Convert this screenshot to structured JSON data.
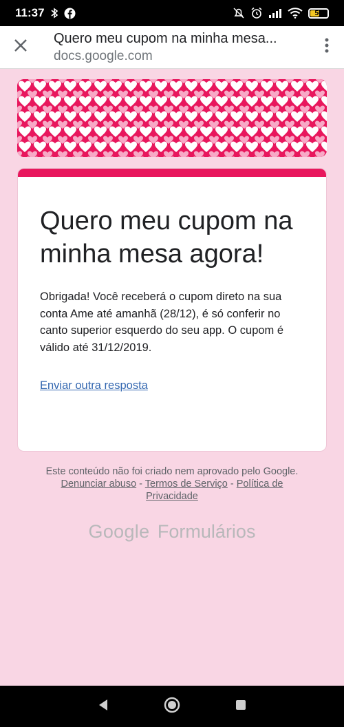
{
  "status_bar": {
    "time": "11:37",
    "battery": "50"
  },
  "browser": {
    "page_title": "Quero meu cupom na minha mesa...",
    "domain": "docs.google.com"
  },
  "form": {
    "title": "Quero meu cupom na minha mesa agora!",
    "message": "Obrigada! Você receberá o cupom direto na sua conta Ame até amanhã (28/12), é só conferir no canto superior esquerdo do seu app. O cupom é válido até 31/12/2019.",
    "resend_link": "Enviar outra resposta"
  },
  "footer": {
    "disclaimer": "Este conteúdo não foi criado nem aprovado pelo Google.",
    "report_abuse": "Denunciar abuso",
    "sep1": " - ",
    "terms": "Termos de Serviço",
    "sep2": " - ",
    "privacy": "Política de Privacidade",
    "brand_google": "Google",
    "brand_forms": "Formulários"
  },
  "colors": {
    "accent": "#e8175d",
    "background": "#f9d6e4"
  }
}
